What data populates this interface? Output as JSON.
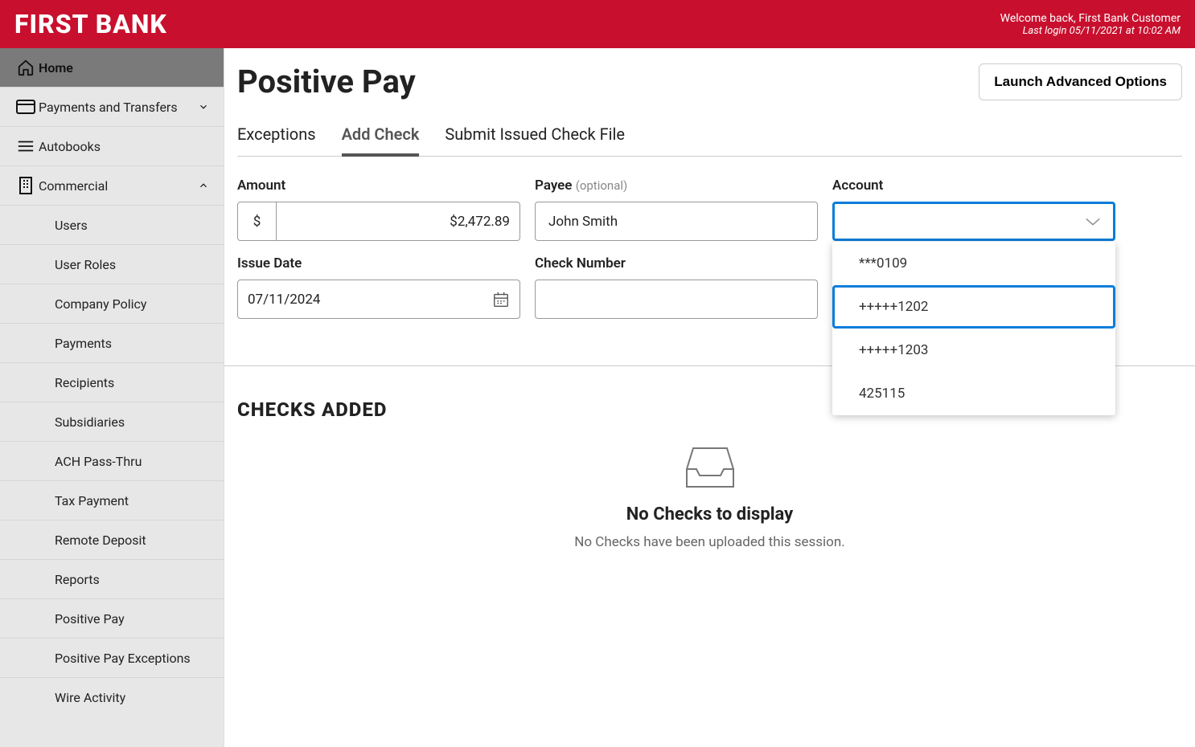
{
  "header": {
    "logo": "FIRST BANK",
    "welcome": "Welcome back, First Bank Customer",
    "last_login": "Last login 05/11/2021 at 10:02 AM"
  },
  "sidebar": {
    "home": "Home",
    "payments_transfers": "Payments and Transfers",
    "autobooks": "Autobooks",
    "commercial": "Commercial",
    "sub": {
      "users": "Users",
      "user_roles": "User Roles",
      "company_policy": "Company Policy",
      "payments": "Payments",
      "recipients": "Recipients",
      "subsidiaries": "Subsidiaries",
      "ach_pass_thru": "ACH Pass-Thru",
      "tax_payment": "Tax Payment",
      "remote_deposit": "Remote Deposit",
      "reports": "Reports",
      "positive_pay": "Positive Pay",
      "positive_pay_exceptions": "Positive Pay Exceptions",
      "wire_activity": "Wire Activity"
    }
  },
  "page": {
    "title": "Positive Pay",
    "launch_button": "Launch Advanced Options"
  },
  "tabs": {
    "exceptions": "Exceptions",
    "add_check": "Add Check",
    "submit_file": "Submit Issued Check File"
  },
  "form": {
    "amount_label": "Amount",
    "amount_prefix": "$",
    "amount_value": "$2,472.89",
    "payee_label": "Payee",
    "payee_optional": "(optional)",
    "payee_value": "John Smith",
    "account_label": "Account",
    "account_value": "",
    "issue_date_label": "Issue Date",
    "issue_date_value": "07/11/2024",
    "check_number_label": "Check Number",
    "check_number_value": ""
  },
  "account_options": {
    "o1": "***0109",
    "o2": "+++++1202",
    "o3": "+++++1203",
    "o4": "425115"
  },
  "checks": {
    "heading": "CHECKS ADDED",
    "empty_title": "No Checks to display",
    "empty_sub": "No Checks have been uploaded this session."
  }
}
